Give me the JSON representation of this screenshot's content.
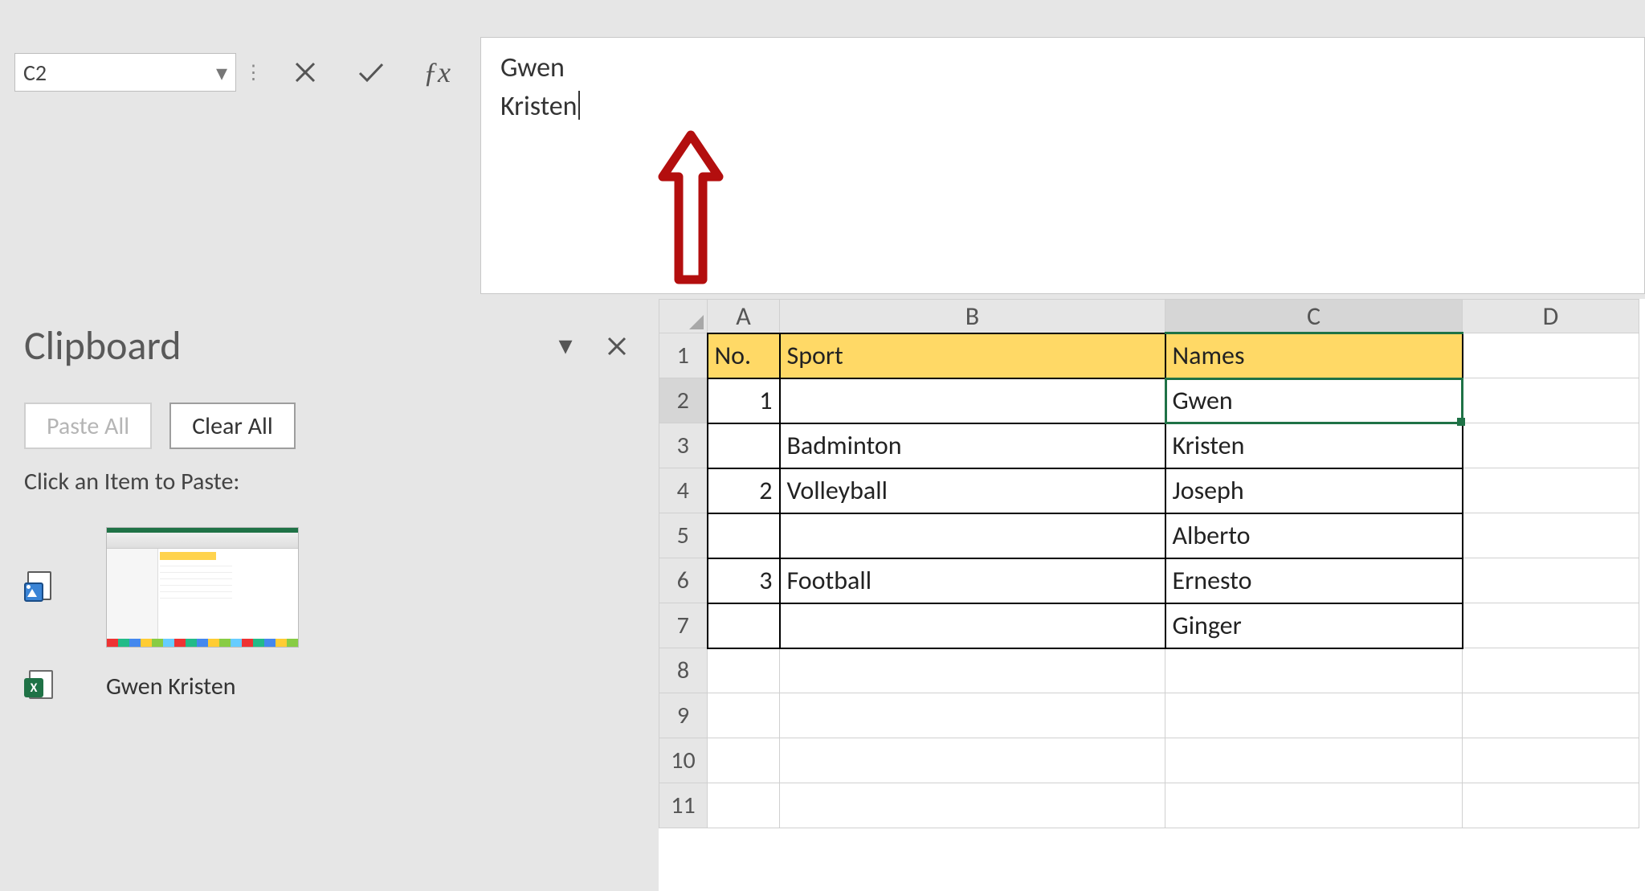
{
  "formula_bar": {
    "cell_ref": "C2",
    "line1": "Gwen",
    "line2": "Kristen"
  },
  "clipboard": {
    "title": "Clipboard",
    "paste_all": "Paste All",
    "clear_all": "Clear All",
    "hint": "Click an Item to Paste:",
    "items": [
      {
        "kind": "image"
      },
      {
        "kind": "text",
        "text": "Gwen Kristen"
      }
    ]
  },
  "grid": {
    "columns": [
      "A",
      "B",
      "C",
      "D"
    ],
    "row_count": 11,
    "active_cell": "C2",
    "headers": {
      "A": "No.",
      "B": "Sport",
      "C": "Names"
    },
    "rows": [
      {
        "A": "1",
        "B": "",
        "C": "Gwen"
      },
      {
        "A": "",
        "B": "Badminton",
        "C": "Kristen"
      },
      {
        "A": "2",
        "B": "Volleyball",
        "C": "Joseph"
      },
      {
        "A": "",
        "B": "",
        "C": "Alberto"
      },
      {
        "A": "3",
        "B": "Football",
        "C": "Ernesto"
      },
      {
        "A": "",
        "B": "",
        "C": "Ginger"
      }
    ]
  }
}
